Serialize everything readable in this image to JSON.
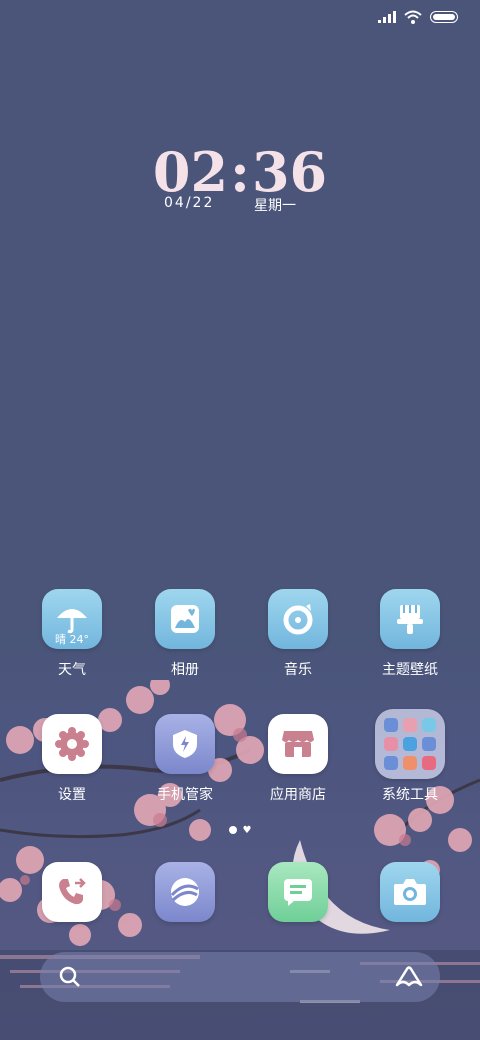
{
  "status_bar": {
    "signal_icon": "signal-icon",
    "wifi_icon": "wifi-icon",
    "battery_icon": "battery-icon",
    "battery_level": 1.0
  },
  "clock": {
    "hours": "02",
    "separator": ":",
    "minutes": "36",
    "date": "04/22",
    "weekday": "星期一"
  },
  "apps_row1": [
    {
      "label": "天气",
      "icon": "umbrella-icon",
      "sub": "晴 24°"
    },
    {
      "label": "相册",
      "icon": "gallery-icon"
    },
    {
      "label": "音乐",
      "icon": "music-icon"
    },
    {
      "label": "主题壁纸",
      "icon": "paintbrush-icon"
    }
  ],
  "apps_row2": [
    {
      "label": "设置",
      "icon": "gear-icon"
    },
    {
      "label": "手机管家",
      "icon": "shield-icon"
    },
    {
      "label": "应用商店",
      "icon": "store-icon"
    },
    {
      "label": "系统工具",
      "icon": "folder-icon"
    }
  ],
  "dock": [
    {
      "icon": "phone-icon"
    },
    {
      "icon": "browser-icon"
    },
    {
      "icon": "messages-icon"
    },
    {
      "icon": "camera-icon"
    }
  ],
  "page_indicator": {
    "pages": 2,
    "current": 1
  },
  "search_bar": {
    "search_icon": "search-icon",
    "assistant_icon": "assistant-icon"
  },
  "colors": {
    "background": "#4a5579",
    "clock_text": "#f5e1e8",
    "icon_blue": "#72b6dd",
    "icon_pink": "#c9808f"
  }
}
